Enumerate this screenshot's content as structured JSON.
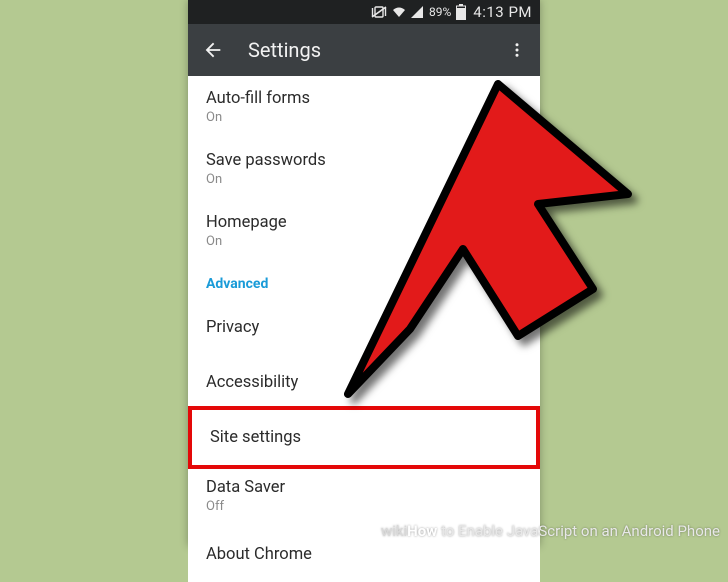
{
  "status": {
    "battery_percent": "89%",
    "time": "4:13 PM"
  },
  "appbar": {
    "title": "Settings"
  },
  "section_advanced": "Advanced",
  "items": {
    "autofill": {
      "title": "Auto-fill forms",
      "state": "On"
    },
    "savepw": {
      "title": "Save passwords",
      "state": "On"
    },
    "homepage": {
      "title": "Homepage",
      "state": "On"
    },
    "privacy": {
      "title": "Privacy"
    },
    "accessibility": {
      "title": "Accessibility"
    },
    "site": {
      "title": "Site settings"
    },
    "datasaver": {
      "title": "Data Saver",
      "state": "Off"
    },
    "about": {
      "title": "About Chrome"
    }
  },
  "watermark": {
    "brand1": "wiki",
    "brand2": "How",
    "text": " to Enable JavaScript on an Android Phone"
  }
}
